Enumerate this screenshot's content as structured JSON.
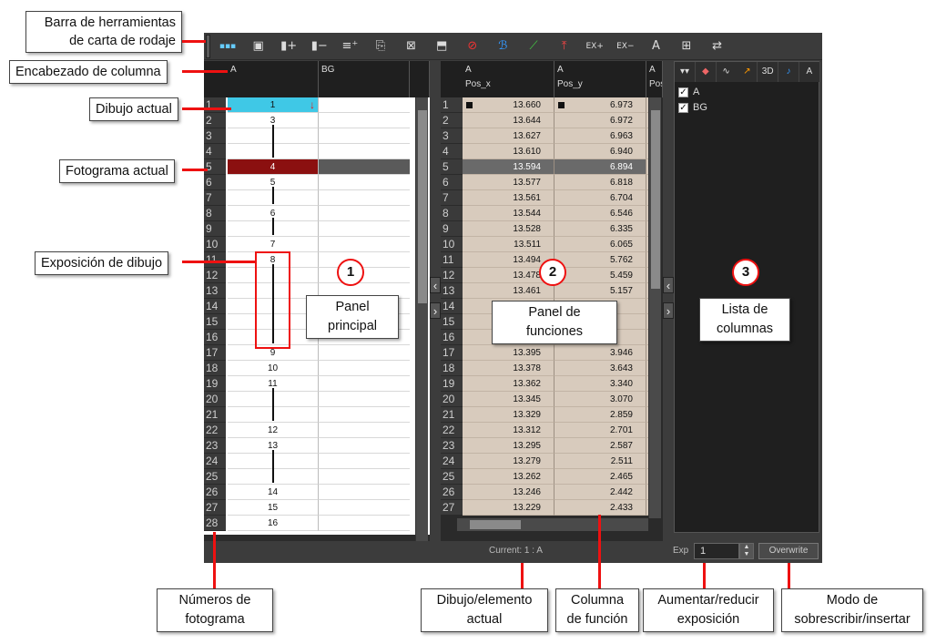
{
  "callouts": {
    "toolbar": [
      "Barra de herramientas",
      "de carta de rodaje"
    ],
    "column_header": "Encabezado de columna",
    "current_drawing": "Dibujo actual",
    "current_frame": "Fotograma actual",
    "drawing_exposure": "Exposición de dibujo",
    "frame_numbers": [
      "Números de",
      "fotograma"
    ],
    "current_element": [
      "Dibujo/elemento",
      "actual"
    ],
    "function_column": [
      "Columna",
      "de función"
    ],
    "exposure": [
      "Aumentar/reducir",
      "exposición"
    ],
    "mode": [
      "Modo de",
      "sobrescribir/insertar"
    ],
    "main_panel": [
      "Panel",
      "principal"
    ],
    "function_panel": [
      "Panel de",
      "funciones"
    ],
    "column_list": [
      "Lista de",
      "columnas"
    ]
  },
  "badges": [
    "1",
    "2",
    "3"
  ],
  "toolbar_icons": [
    "dots-icon",
    "panel-toggle-icon",
    "add-column-icon",
    "remove-column-icon",
    "fill-frames-icon",
    "scan-icon",
    "drawing-replace-icon",
    "library-icon",
    "turn-off-icon",
    "script-icon",
    "brush-icon",
    "increase-icon",
    "expand-ex-icon",
    "reduce-ex-icon",
    "text-icon",
    "insert-icon",
    "move-icon"
  ],
  "main_panel": {
    "columns": [
      "A",
      "BG"
    ],
    "rows": [
      "1",
      "2",
      "3",
      "4",
      "5",
      "6",
      "7",
      "8",
      "9",
      "10",
      "11",
      "12",
      "13",
      "14",
      "15",
      "16",
      "17",
      "18",
      "19",
      "20",
      "21",
      "22",
      "23",
      "24",
      "25",
      "26",
      "27",
      "28"
    ],
    "cells": [
      "1",
      "3",
      "",
      "",
      "4",
      "5",
      "",
      "6",
      "",
      "7",
      "8",
      "",
      "",
      "",
      "",
      "",
      "9",
      "10",
      "11",
      "",
      "",
      "12",
      "13",
      "",
      "",
      "14",
      "15",
      "16"
    ]
  },
  "function_panel": {
    "columns": [
      {
        "layer": "A",
        "name": "Pos_x"
      },
      {
        "layer": "A",
        "name": "Pos_y"
      },
      {
        "layer": "A",
        "name": "Pos"
      }
    ],
    "rows": [
      "1",
      "2",
      "3",
      "4",
      "5",
      "6",
      "7",
      "8",
      "9",
      "10",
      "11",
      "12",
      "13",
      "14",
      "15",
      "16",
      "17",
      "18",
      "19",
      "20",
      "21",
      "22",
      "23",
      "24",
      "25",
      "26",
      "27"
    ],
    "pos_x": [
      "13.660",
      "13.644",
      "13.627",
      "13.610",
      "13.594",
      "13.577",
      "13.561",
      "13.544",
      "13.528",
      "13.511",
      "13.494",
      "13.478",
      "13.461",
      "",
      "",
      "",
      "13.395",
      "13.378",
      "13.362",
      "13.345",
      "13.329",
      "13.312",
      "13.295",
      "13.279",
      "13.262",
      "13.246",
      "13.229"
    ],
    "pos_y": [
      "6.973",
      "6.972",
      "6.963",
      "6.940",
      "6.894",
      "6.818",
      "6.704",
      "6.546",
      "6.335",
      "6.065",
      "5.762",
      "5.459",
      "5.157",
      "",
      "",
      "",
      "3.946",
      "3.643",
      "3.340",
      "3.070",
      "2.859",
      "2.701",
      "2.587",
      "2.511",
      "2.465",
      "2.442",
      "2.433"
    ]
  },
  "column_list": {
    "tabs": [
      "▾▾",
      "◆",
      "∿",
      "↗",
      "3D",
      "♪",
      "A"
    ],
    "items": [
      "A",
      "BG"
    ]
  },
  "status": {
    "current": "Current: 1 : A",
    "exp_label": "Exp",
    "exp_value": "1",
    "mode": "Overwrite"
  },
  "colors": {
    "current_drawing": "#3fc8e6",
    "current_frame": "#8b1010",
    "function_cell": "#d8cbbd",
    "callout_line": "#ee1111"
  }
}
